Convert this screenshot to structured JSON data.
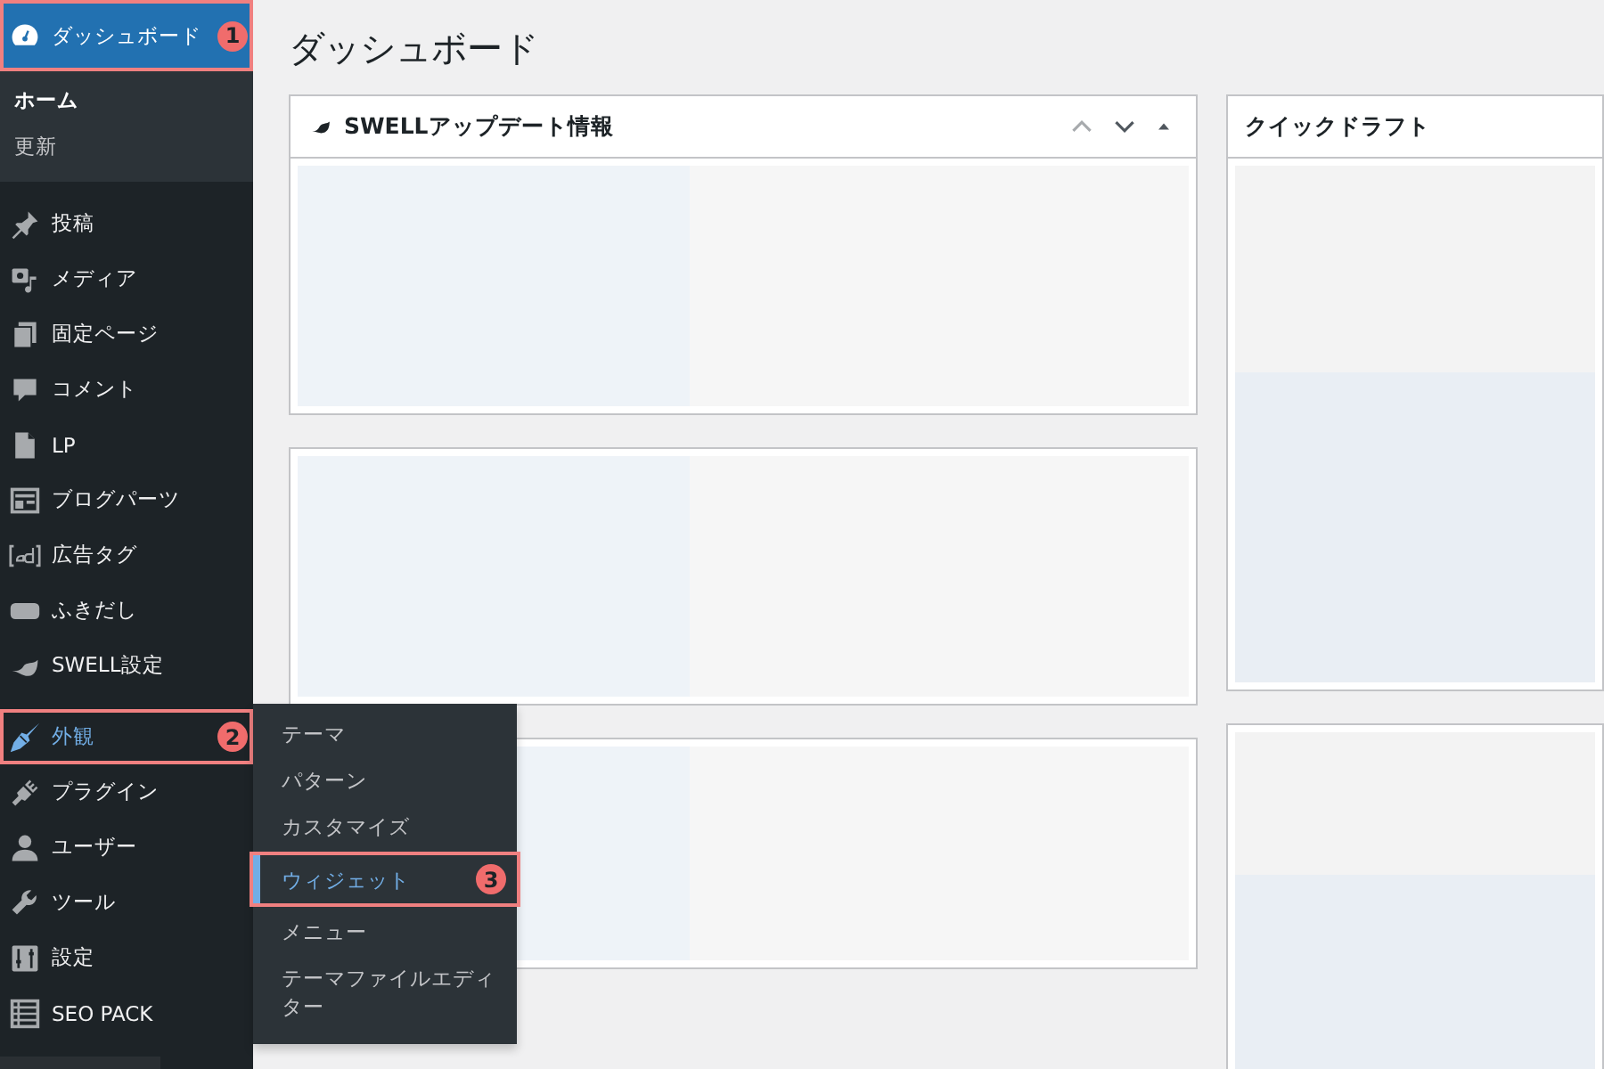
{
  "sidebar": {
    "groups": [
      [
        {
          "label": "ダッシュボード",
          "selected": true,
          "open": false,
          "badge": "1",
          "submenu": [
            {
              "label": "ホーム",
              "selected": true
            },
            {
              "label": "更新",
              "selected": false
            }
          ]
        }
      ],
      [
        {
          "label": "投稿",
          "selected": false,
          "open": false
        },
        {
          "label": "メディア",
          "selected": false,
          "open": false
        },
        {
          "label": "固定ページ",
          "selected": false,
          "open": false
        },
        {
          "label": "コメント",
          "selected": false,
          "open": false
        },
        {
          "label": "LP",
          "selected": false,
          "open": false
        },
        {
          "label": "ブログパーツ",
          "selected": false,
          "open": false
        },
        {
          "label": "広告タグ",
          "selected": false,
          "open": false
        },
        {
          "label": "ふきだし",
          "selected": false,
          "open": false
        },
        {
          "label": "SWELL設定",
          "selected": false,
          "open": false
        }
      ],
      [
        {
          "label": "外観",
          "selected": false,
          "open": true,
          "badge": "2"
        },
        {
          "label": "プラグイン",
          "selected": false,
          "open": false
        },
        {
          "label": "ユーザー",
          "selected": false,
          "open": false
        },
        {
          "label": "ツール",
          "selected": false,
          "open": false
        },
        {
          "label": "設定",
          "selected": false,
          "open": false
        },
        {
          "label": "SEO PACK",
          "selected": false,
          "open": false
        }
      ]
    ]
  },
  "flyout": {
    "items": [
      {
        "label": "テーマ",
        "selected": false
      },
      {
        "label": "パターン",
        "selected": false
      },
      {
        "label": "カスタマイズ",
        "selected": false
      },
      {
        "label": "ウィジェット",
        "selected": true,
        "badge": "3"
      },
      {
        "label": "メニュー",
        "selected": false
      },
      {
        "label": "テーマファイルエディター",
        "selected": false
      }
    ]
  },
  "page_title": "ダッシュボード",
  "panels": [
    {
      "title": "SWELLアップデート情報"
    },
    {
      "title": "クイックドラフト"
    }
  ]
}
